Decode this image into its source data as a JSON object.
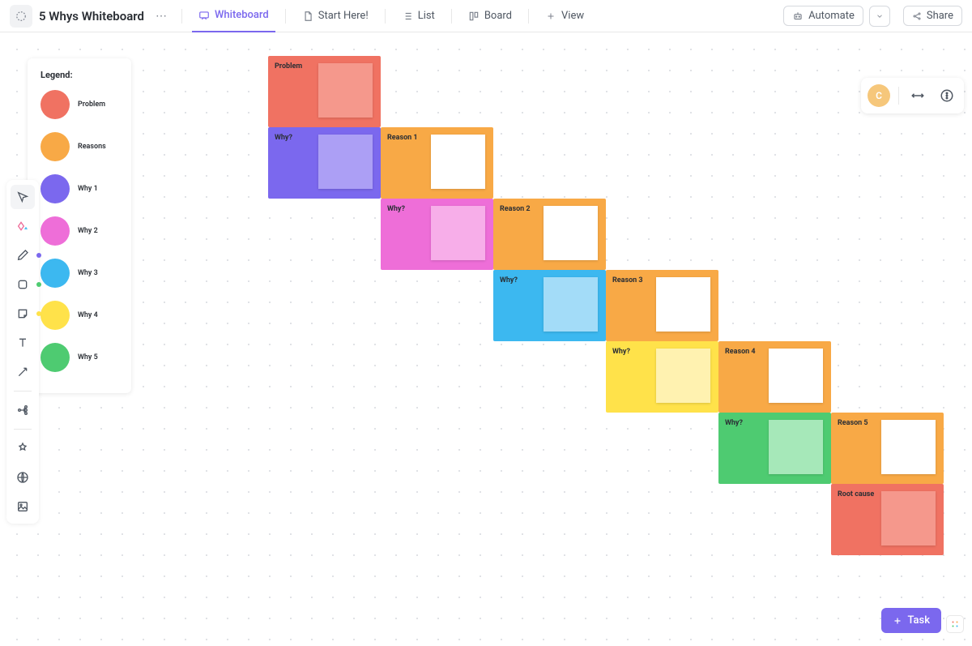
{
  "header": {
    "title": "5 Whys Whiteboard",
    "nav": {
      "whiteboard": "Whiteboard",
      "start_here": "Start Here!",
      "list": "List",
      "board": "Board",
      "view": "View"
    },
    "automate": "Automate",
    "share": "Share"
  },
  "canvas_tools": {
    "avatar_letter": "C"
  },
  "legend": {
    "title": "Legend:",
    "items": [
      {
        "label": "Problem",
        "color": "#f07262"
      },
      {
        "label": "Reasons",
        "color": "#f8a946"
      },
      {
        "label": "Why 1",
        "color": "#7b68ee"
      },
      {
        "label": "Why 2",
        "color": "#ee6ed8"
      },
      {
        "label": "Why 3",
        "color": "#3cb8f0"
      },
      {
        "label": "Why 4",
        "color": "#ffe24a"
      },
      {
        "label": "Why 5",
        "color": "#4ecb71"
      }
    ]
  },
  "cards": {
    "problem": {
      "label": "Problem",
      "bg": "#f07262",
      "note": "#f5988c"
    },
    "why1": {
      "label": "Why?",
      "bg": "#7b68ee",
      "note": "#ac9ff5"
    },
    "reason1": {
      "label": "Reason 1",
      "bg": "#f8a946",
      "note": "#ffffff"
    },
    "why2": {
      "label": "Why?",
      "bg": "#ee6ed8",
      "note": "#f7aee9"
    },
    "reason2": {
      "label": "Reason 2",
      "bg": "#f8a946",
      "note": "#ffffff"
    },
    "why3": {
      "label": "Why?",
      "bg": "#3cb8f0",
      "note": "#a3dcf8"
    },
    "reason3": {
      "label": "Reason 3",
      "bg": "#f8a946",
      "note": "#ffffff"
    },
    "why4": {
      "label": "Why?",
      "bg": "#ffe24a",
      "note": "#fff2b0"
    },
    "reason4": {
      "label": "Reason 4",
      "bg": "#f8a946",
      "note": "#ffffff"
    },
    "why5": {
      "label": "Why?",
      "bg": "#4ecb71",
      "note": "#a6e8b9"
    },
    "reason5": {
      "label": "Reason 5",
      "bg": "#f8a946",
      "note": "#ffffff"
    },
    "rootcause": {
      "label": "Root cause",
      "bg": "#f07262",
      "note": "#f5988c"
    }
  },
  "task_button": "Task"
}
